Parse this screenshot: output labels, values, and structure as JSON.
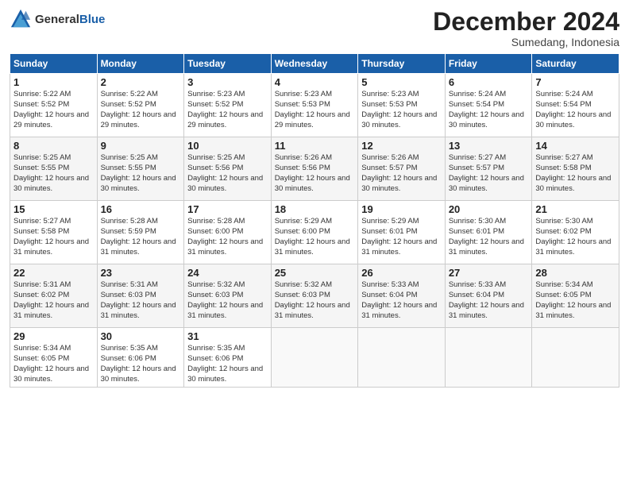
{
  "header": {
    "logo": {
      "general": "General",
      "blue": "Blue"
    },
    "title": "December 2024",
    "location": "Sumedang, Indonesia"
  },
  "days_of_week": [
    "Sunday",
    "Monday",
    "Tuesday",
    "Wednesday",
    "Thursday",
    "Friday",
    "Saturday"
  ],
  "weeks": [
    [
      {
        "day": "1",
        "sunrise": "5:22 AM",
        "sunset": "5:52 PM",
        "daylight": "12 hours and 29 minutes."
      },
      {
        "day": "2",
        "sunrise": "5:22 AM",
        "sunset": "5:52 PM",
        "daylight": "12 hours and 29 minutes."
      },
      {
        "day": "3",
        "sunrise": "5:23 AM",
        "sunset": "5:52 PM",
        "daylight": "12 hours and 29 minutes."
      },
      {
        "day": "4",
        "sunrise": "5:23 AM",
        "sunset": "5:53 PM",
        "daylight": "12 hours and 29 minutes."
      },
      {
        "day": "5",
        "sunrise": "5:23 AM",
        "sunset": "5:53 PM",
        "daylight": "12 hours and 30 minutes."
      },
      {
        "day": "6",
        "sunrise": "5:24 AM",
        "sunset": "5:54 PM",
        "daylight": "12 hours and 30 minutes."
      },
      {
        "day": "7",
        "sunrise": "5:24 AM",
        "sunset": "5:54 PM",
        "daylight": "12 hours and 30 minutes."
      }
    ],
    [
      {
        "day": "8",
        "sunrise": "5:25 AM",
        "sunset": "5:55 PM",
        "daylight": "12 hours and 30 minutes."
      },
      {
        "day": "9",
        "sunrise": "5:25 AM",
        "sunset": "5:55 PM",
        "daylight": "12 hours and 30 minutes."
      },
      {
        "day": "10",
        "sunrise": "5:25 AM",
        "sunset": "5:56 PM",
        "daylight": "12 hours and 30 minutes."
      },
      {
        "day": "11",
        "sunrise": "5:26 AM",
        "sunset": "5:56 PM",
        "daylight": "12 hours and 30 minutes."
      },
      {
        "day": "12",
        "sunrise": "5:26 AM",
        "sunset": "5:57 PM",
        "daylight": "12 hours and 30 minutes."
      },
      {
        "day": "13",
        "sunrise": "5:27 AM",
        "sunset": "5:57 PM",
        "daylight": "12 hours and 30 minutes."
      },
      {
        "day": "14",
        "sunrise": "5:27 AM",
        "sunset": "5:58 PM",
        "daylight": "12 hours and 30 minutes."
      }
    ],
    [
      {
        "day": "15",
        "sunrise": "5:27 AM",
        "sunset": "5:58 PM",
        "daylight": "12 hours and 31 minutes."
      },
      {
        "day": "16",
        "sunrise": "5:28 AM",
        "sunset": "5:59 PM",
        "daylight": "12 hours and 31 minutes."
      },
      {
        "day": "17",
        "sunrise": "5:28 AM",
        "sunset": "6:00 PM",
        "daylight": "12 hours and 31 minutes."
      },
      {
        "day": "18",
        "sunrise": "5:29 AM",
        "sunset": "6:00 PM",
        "daylight": "12 hours and 31 minutes."
      },
      {
        "day": "19",
        "sunrise": "5:29 AM",
        "sunset": "6:01 PM",
        "daylight": "12 hours and 31 minutes."
      },
      {
        "day": "20",
        "sunrise": "5:30 AM",
        "sunset": "6:01 PM",
        "daylight": "12 hours and 31 minutes."
      },
      {
        "day": "21",
        "sunrise": "5:30 AM",
        "sunset": "6:02 PM",
        "daylight": "12 hours and 31 minutes."
      }
    ],
    [
      {
        "day": "22",
        "sunrise": "5:31 AM",
        "sunset": "6:02 PM",
        "daylight": "12 hours and 31 minutes."
      },
      {
        "day": "23",
        "sunrise": "5:31 AM",
        "sunset": "6:03 PM",
        "daylight": "12 hours and 31 minutes."
      },
      {
        "day": "24",
        "sunrise": "5:32 AM",
        "sunset": "6:03 PM",
        "daylight": "12 hours and 31 minutes."
      },
      {
        "day": "25",
        "sunrise": "5:32 AM",
        "sunset": "6:03 PM",
        "daylight": "12 hours and 31 minutes."
      },
      {
        "day": "26",
        "sunrise": "5:33 AM",
        "sunset": "6:04 PM",
        "daylight": "12 hours and 31 minutes."
      },
      {
        "day": "27",
        "sunrise": "5:33 AM",
        "sunset": "6:04 PM",
        "daylight": "12 hours and 31 minutes."
      },
      {
        "day": "28",
        "sunrise": "5:34 AM",
        "sunset": "6:05 PM",
        "daylight": "12 hours and 31 minutes."
      }
    ],
    [
      {
        "day": "29",
        "sunrise": "5:34 AM",
        "sunset": "6:05 PM",
        "daylight": "12 hours and 30 minutes."
      },
      {
        "day": "30",
        "sunrise": "5:35 AM",
        "sunset": "6:06 PM",
        "daylight": "12 hours and 30 minutes."
      },
      {
        "day": "31",
        "sunrise": "5:35 AM",
        "sunset": "6:06 PM",
        "daylight": "12 hours and 30 minutes."
      },
      null,
      null,
      null,
      null
    ]
  ]
}
